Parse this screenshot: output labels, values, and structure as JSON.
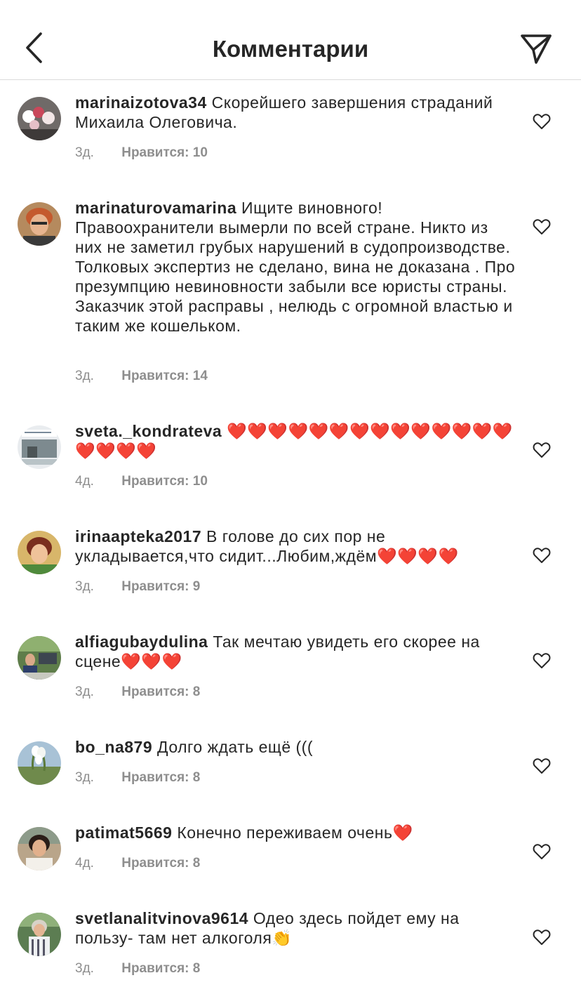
{
  "header": {
    "title": "Комментарии",
    "back_icon": "chevron-left-icon",
    "share_icon": "paper-plane-icon"
  },
  "colors": {
    "text": "#262626",
    "secondary": "#8e8e8e",
    "divider": "#dbdbdb"
  },
  "comments": [
    {
      "username": "marinaizotova34",
      "text": "Скорейшего завершения страданий Михаила Олеговича.",
      "time": "3д.",
      "likes": "Нравится: 10"
    },
    {
      "username": "marinaturovamarina",
      "text": "Ищите виновного! Правоохранители вымерли по всей стране. Никто из них не заметил грубых нарушений в судопроизводстве. Толковых экспертиз не сделано, вина не доказана . Про презумпцию невиновности забыли все юристы страны. Заказчик этой расправы , нелюдь с огромной властью и таким же кошельком.",
      "time": "3д.",
      "likes": "Нравится: 14"
    },
    {
      "username": "sveta._kondrateva",
      "text": "❤️❤️❤️❤️❤️❤️❤️❤️❤️❤️❤️❤️❤️❤️❤️❤️❤️❤️",
      "time": "4д.",
      "likes": "Нравится: 10"
    },
    {
      "username": "irinaapteka2017",
      "text": "В голове до сих пор  не укладывается,что сидит...Любим,ждём❤️❤️❤️❤️",
      "time": "3д.",
      "likes": "Нравится: 9"
    },
    {
      "username": "alfiagubaydulina",
      "text": "Так мечтаю увидеть его скорее на сцене❤️❤️❤️",
      "time": "3д.",
      "likes": "Нравится: 8"
    },
    {
      "username": "bo_na879",
      "text": "Долго ждать ещё (((",
      "time": "3д.",
      "likes": "Нравится: 8"
    },
    {
      "username": "patimat5669",
      "text": "Конечно переживаем очень❤️",
      "time": "4д.",
      "likes": "Нравится: 8"
    },
    {
      "username": "svetlanalitvinova9614",
      "text": "Одео здесь пойдет ему на пользу- там нет алкоголя👏",
      "time": "3д.",
      "likes": "Нравится: 8"
    }
  ]
}
